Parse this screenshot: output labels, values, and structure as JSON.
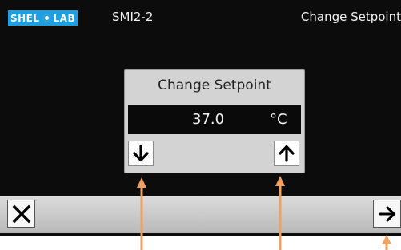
{
  "header": {
    "logo_part1": "SHEL",
    "logo_part2": "LAB",
    "device_name": "SMI2-2",
    "screen_title": "Change Setpoint"
  },
  "dialog": {
    "title": "Change Setpoint",
    "value": "37.0",
    "unit": "°C"
  },
  "icons": {
    "decrease": "arrow-down-icon",
    "increase": "arrow-up-icon",
    "cancel": "close-icon",
    "next": "arrow-right-icon"
  },
  "colors": {
    "screen_background": "#0c0c0c",
    "logo_blue": "#1d9fe0",
    "dialog_background": "#d3d3d3",
    "annotation_arrow": "#f0a060"
  }
}
